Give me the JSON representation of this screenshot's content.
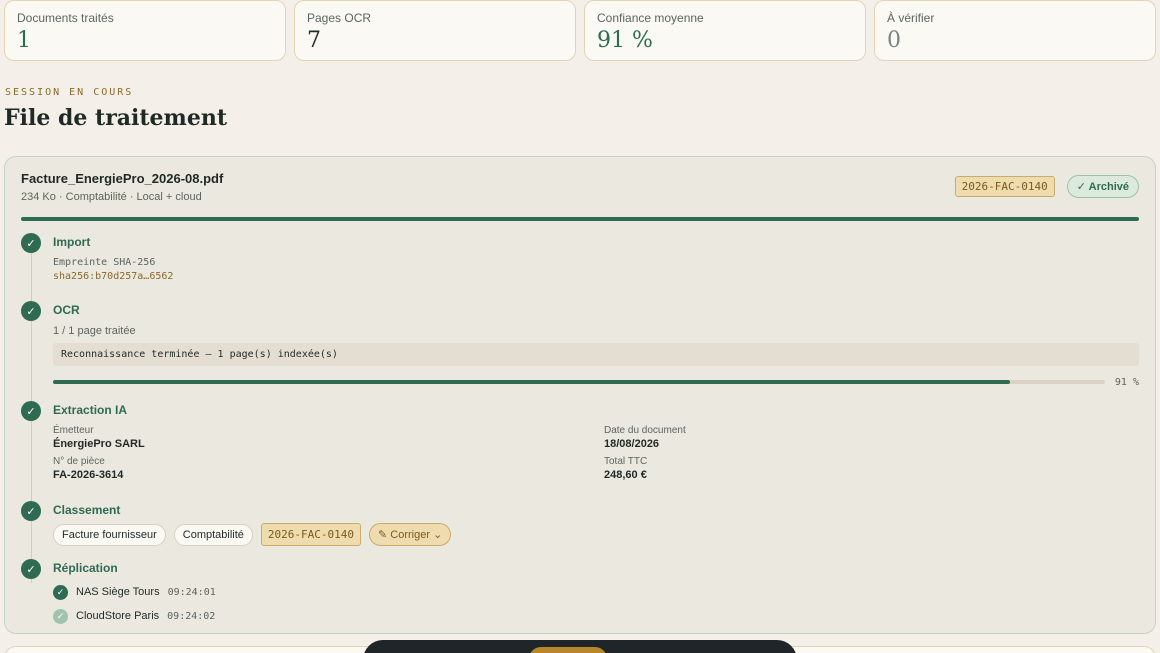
{
  "stats": [
    {
      "label": "Documents traités",
      "value": "1"
    },
    {
      "label": "Pages OCR",
      "value": "7"
    },
    {
      "label": "Confiance moyenne",
      "value": "91 %"
    },
    {
      "label": "À vérifier",
      "value": "0"
    }
  ],
  "section": {
    "eyebrow": "SESSION EN COURS",
    "title": "File de traitement"
  },
  "document": {
    "name": "Facture_EnergiePro_2026-08.pdf",
    "meta": "234 Ko · Comptabilité · Local + cloud",
    "ref": "2026-FAC-0140",
    "status": "Archivé",
    "progress": 1.0
  },
  "steps": {
    "import": {
      "title": "Import",
      "hash_label": "Empreinte SHA-256",
      "hash_value": "sha256:b70d257a…6562"
    },
    "ocr": {
      "title": "OCR",
      "pages": "1 / 1 page traitée",
      "log": "Reconnaissance terminée — 1 page(s) indexée(s)",
      "confidence": 91,
      "confidence_label": "91 %"
    },
    "extraction": {
      "title": "Extraction IA",
      "fields": [
        {
          "label": "Émetteur",
          "value": "ÉnergiePro SARL"
        },
        {
          "label": "Date du document",
          "value": "18/08/2026"
        },
        {
          "label": "N° de pièce",
          "value": "FA-2026-3614"
        },
        {
          "label": "Total TTC",
          "value": "248,60 €"
        }
      ]
    },
    "classement": {
      "title": "Classement",
      "type": "Facture fournisseur",
      "category": "Comptabilité",
      "ref": "2026-FAC-0140",
      "action": "Corriger"
    },
    "replication": {
      "title": "Réplication",
      "targets": [
        {
          "name": "NAS Siège Tours",
          "time": "09:24:01"
        },
        {
          "name": "CloudStore Paris",
          "time": "09:24:02"
        }
      ]
    }
  },
  "icons": {
    "step": "check-icon",
    "edit": "pencil-icon",
    "dropdown": "chevron-down-icon"
  },
  "colors": {
    "accent": "#2e6b52",
    "gold": "#8a6a2a",
    "background": "#f4f0e9"
  }
}
